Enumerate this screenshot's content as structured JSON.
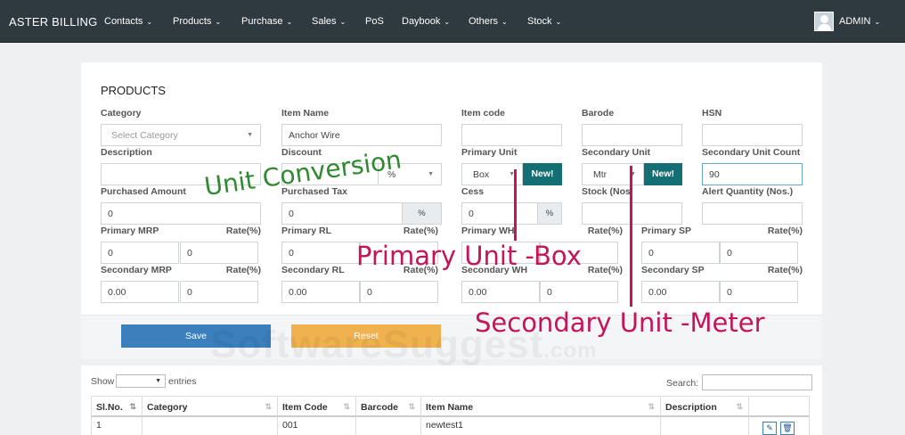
{
  "nav": {
    "brand": "ASTER BILLING",
    "items": [
      {
        "label": "Contacts",
        "caret": true
      },
      {
        "label": "Products",
        "caret": true
      },
      {
        "label": "Purchase",
        "caret": true
      },
      {
        "label": "Sales",
        "caret": true
      },
      {
        "label": "PoS",
        "caret": false
      },
      {
        "label": "Daybook",
        "caret": true
      },
      {
        "label": "Others",
        "caret": true
      },
      {
        "label": "Stock",
        "caret": true
      }
    ],
    "user": "ADMIN",
    "caret_glyph": "⌄"
  },
  "form": {
    "title": "PRODUCTS",
    "category": {
      "label": "Category",
      "placeholder": "Select Category"
    },
    "item_name": {
      "label": "Item Name",
      "value": "Anchor Wire"
    },
    "item_code": {
      "label": "Item code",
      "value": ""
    },
    "barcode": {
      "label": "Barode",
      "value": ""
    },
    "hsn": {
      "label": "HSN",
      "value": ""
    },
    "description": {
      "label": "Description",
      "value": ""
    },
    "discount": {
      "label": "Discount",
      "value": "",
      "unit": "%"
    },
    "primary_unit": {
      "label": "Primary Unit",
      "value": "Box",
      "new_label": "New!"
    },
    "secondary_unit": {
      "label": "Secondary Unit",
      "value": "Mtr",
      "new_label": "New!"
    },
    "secondary_unit_count": {
      "label": "Secondary Unit Count",
      "value": "90"
    },
    "purchased_amount": {
      "label": "Purchased Amount",
      "value": "0"
    },
    "purchased_tax": {
      "label": "Purchased Tax",
      "value": "0",
      "unit": "%"
    },
    "cess": {
      "label": "Cess",
      "value": "0",
      "unit": "%"
    },
    "stock": {
      "label": "Stock (Nos",
      "value": ""
    },
    "alert_qty": {
      "label": "Alert Quantity (Nos.)",
      "value": ""
    },
    "rate_label": "Rate(%)",
    "primary_mrp": {
      "label": "Primary MRP",
      "value": "0",
      "rate": "0"
    },
    "primary_rl": {
      "label": "Primary RL",
      "value": "0",
      "rate": ""
    },
    "primary_wh": {
      "label": "Primary WH",
      "value": "",
      "rate": ""
    },
    "primary_sp": {
      "label": "Primary SP",
      "value": "0",
      "rate": "0"
    },
    "secondary_mrp": {
      "label": "Secondary MRP",
      "value": "0.00",
      "rate": "0"
    },
    "secondary_rl": {
      "label": "Secondary RL",
      "value": "0.00",
      "rate": "0"
    },
    "secondary_wh": {
      "label": "Secondary WH",
      "value": "0.00",
      "rate": "0"
    },
    "secondary_sp": {
      "label": "Secondary SP",
      "value": "0.00",
      "rate": "0"
    }
  },
  "buttons": {
    "save": "Save",
    "reset": "Reset"
  },
  "table": {
    "show_label": "Show",
    "entries_label": "entries",
    "search_label": "Search:",
    "headers": [
      "Sl.No.",
      "Category",
      "Item Code",
      "Barcode",
      "Item Name",
      "Description"
    ],
    "sort_glyph": "⇅",
    "rows": [
      {
        "sl": "1",
        "category": "",
        "item_code": "001",
        "barcode": "",
        "item_name": "newtest1",
        "description": ""
      }
    ],
    "edit_glyph": "✎",
    "delete_glyph": "🗑"
  },
  "annotations": {
    "unit_conversion": "Unit Conversion",
    "primary_unit": "Primary Unit -Box",
    "secondary_unit": "Secondary Unit -Meter"
  },
  "watermark": {
    "main": "SoftwareSuggest",
    "suffix": ".com"
  },
  "colors": {
    "nav_bg": "#2f3940",
    "save": "#3b7fbd",
    "reset": "#f0b24e",
    "new_button": "#136f73",
    "annotation_green": "#2f8a2f",
    "annotation_pink": "#c4145a"
  }
}
